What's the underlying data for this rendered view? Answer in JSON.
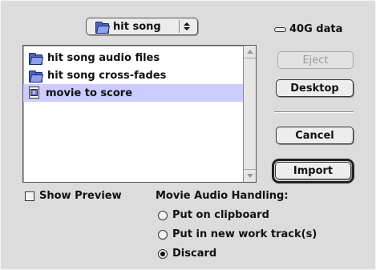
{
  "location_popup": {
    "label": "hit song",
    "icon": "folder-icon"
  },
  "disk": {
    "label": "40G data",
    "icon": "disk-icon"
  },
  "files": [
    {
      "label": "hit song audio files",
      "icon": "folder-icon",
      "selected": false
    },
    {
      "label": "hit song cross-fades",
      "icon": "folder-icon",
      "selected": false
    },
    {
      "label": "movie to score",
      "icon": "movie-document-icon",
      "selected": true
    }
  ],
  "buttons": {
    "eject": "Eject",
    "desktop": "Desktop",
    "cancel": "Cancel",
    "import": "Import"
  },
  "show_preview": {
    "label": "Show Preview",
    "checked": false
  },
  "audio_handling": {
    "label": "Movie Audio Handling:",
    "options": [
      {
        "label": "Put on clipboard",
        "selected": false
      },
      {
        "label": "Put in new work track(s)",
        "selected": false
      },
      {
        "label": "Discard",
        "selected": true
      }
    ]
  },
  "colors": {
    "selection": "#ccccff",
    "folder": "#4f63c6",
    "background": "#dcdcdc"
  }
}
